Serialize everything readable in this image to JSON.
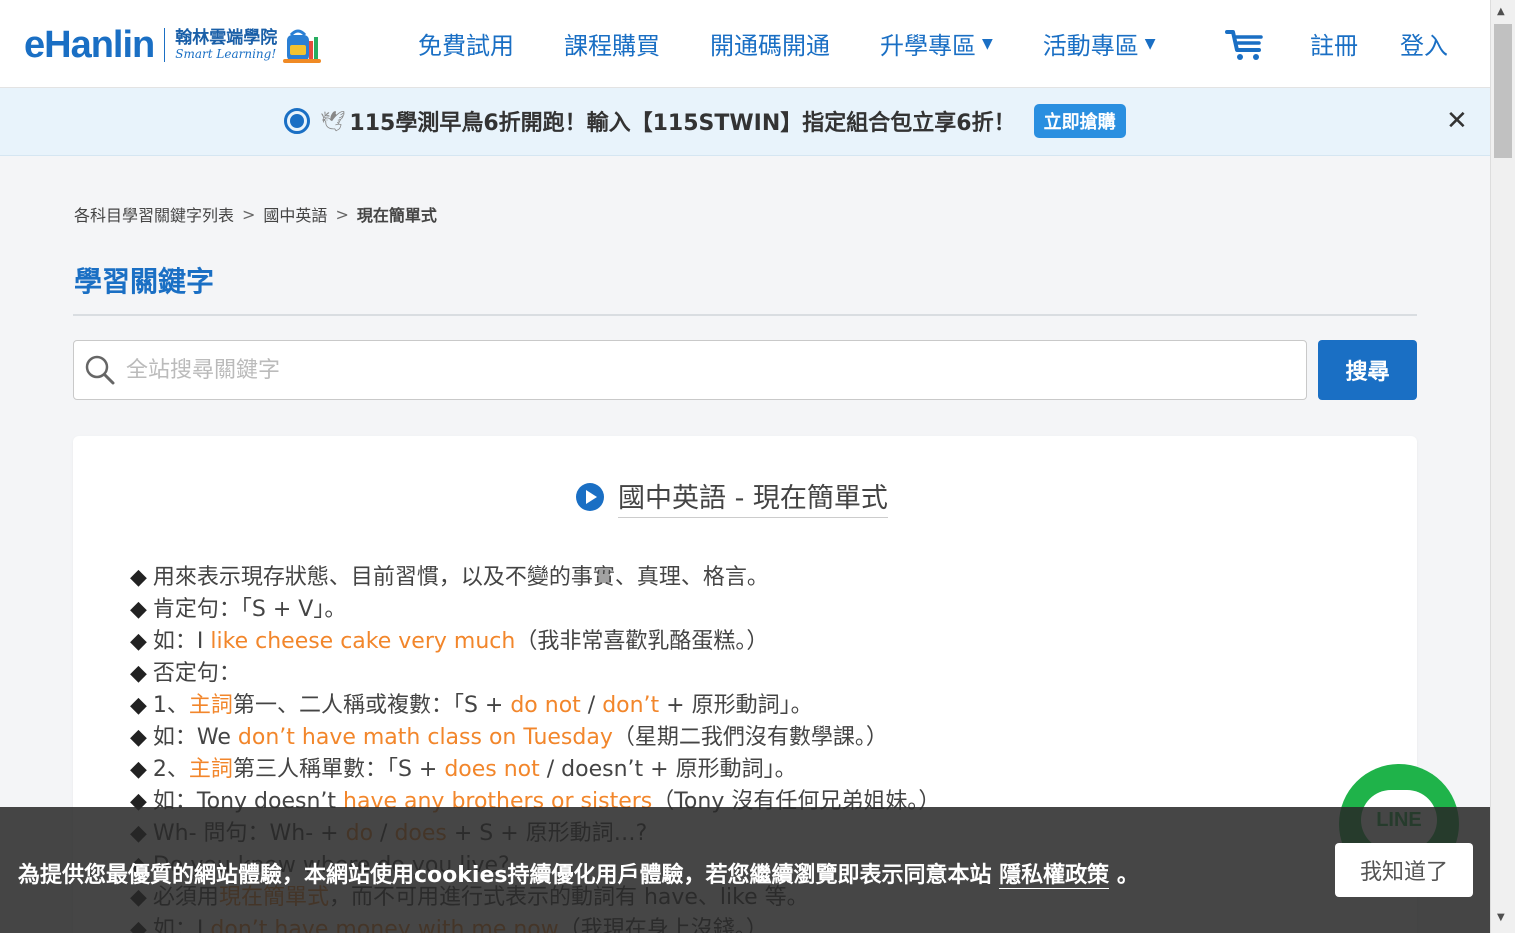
{
  "header": {
    "logo_main": "eHanlin",
    "logo_cn": "翰林雲端學院",
    "logo_en": "Smart Learning!",
    "nav": [
      {
        "label": "免費試用",
        "dropdown": false
      },
      {
        "label": "課程購買",
        "dropdown": false
      },
      {
        "label": "開通碼開通",
        "dropdown": false
      },
      {
        "label": "升學專區",
        "dropdown": true
      },
      {
        "label": "活動專區",
        "dropdown": true
      }
    ],
    "caret": "▼",
    "register": "註冊",
    "login": "登入"
  },
  "promo": {
    "text": "115學測早鳥6折開跑！輸入【115STWIN】指定組合包立享6折！",
    "button": "立即搶購",
    "close": "✕"
  },
  "breadcrumb": {
    "items": [
      "各科目學習關鍵字列表",
      "國中英語",
      "現在簡單式"
    ],
    "separator": ">"
  },
  "section_title": "學習關鍵字",
  "search": {
    "placeholder": "全站搜尋關鍵字",
    "value": "",
    "button": "搜尋"
  },
  "card": {
    "title": "國中英語 - 現在簡單式",
    "bullet": "◆",
    "lines": [
      [
        {
          "t": "用來表示現存狀態、目前習慣，以及不變的事實、真理、格言。"
        }
      ],
      [
        {
          "t": "肯定句：「S + V」。"
        }
      ],
      [
        {
          "t": "如：I "
        },
        {
          "t": "like cheese cake very much",
          "hl": true
        },
        {
          "t": "（我非常喜歡乳酪蛋糕。）"
        }
      ],
      [
        {
          "t": "否定句："
        }
      ],
      [
        {
          "t": "1、"
        },
        {
          "t": "主詞",
          "hl": true
        },
        {
          "t": "第一、二人稱或複數：「S + "
        },
        {
          "t": "do not",
          "hl": true
        },
        {
          "t": " / "
        },
        {
          "t": "don’t",
          "hl": true
        },
        {
          "t": " + 原形動詞」。"
        }
      ],
      [
        {
          "t": "如：We "
        },
        {
          "t": "don’t have math class on Tuesday",
          "hl": true
        },
        {
          "t": "（星期二我們沒有數學課。）"
        }
      ],
      [
        {
          "t": "2、"
        },
        {
          "t": "主詞",
          "hl": true
        },
        {
          "t": "第三人稱單數：「S + "
        },
        {
          "t": "does not",
          "hl": true
        },
        {
          "t": " / doesn’t + 原形動詞」。"
        }
      ],
      [
        {
          "t": "如：Tony doesn’t "
        },
        {
          "t": "have any brothers or sisters",
          "hl": true
        },
        {
          "t": "（Tony 沒有任何兄弟姐妹。）"
        }
      ],
      [
        {
          "t": "Wh- 問句：Wh- + "
        },
        {
          "t": "do",
          "hl": true
        },
        {
          "t": " / "
        },
        {
          "t": "does",
          "hl": true
        },
        {
          "t": " + S + 原形動詞…?"
        }
      ],
      [
        {
          "t": "Do you know where do you live?"
        }
      ],
      [
        {
          "t": "必須用"
        },
        {
          "t": "現在簡單式",
          "hl": true
        },
        {
          "t": "，而不可用進行式表示的動詞有 have、like 等。"
        }
      ],
      [
        {
          "t": "如：I "
        },
        {
          "t": "don’t have money with me now",
          "hl": true
        },
        {
          "t": "（我現在身上沒錢。）"
        }
      ]
    ]
  },
  "cookie": {
    "text": "為提供您最優質的網站體驗，本網站使用cookies持續優化用戶體驗，若您繼續瀏覽即表示同意本站",
    "link": "隱私權政策",
    "suffix": "。",
    "button": "我知道了"
  },
  "line_fab": {
    "label": "LINE"
  },
  "colors": {
    "brand": "#1a6fc4",
    "highlight": "#f2862b",
    "line_green": "#1fb34a"
  }
}
